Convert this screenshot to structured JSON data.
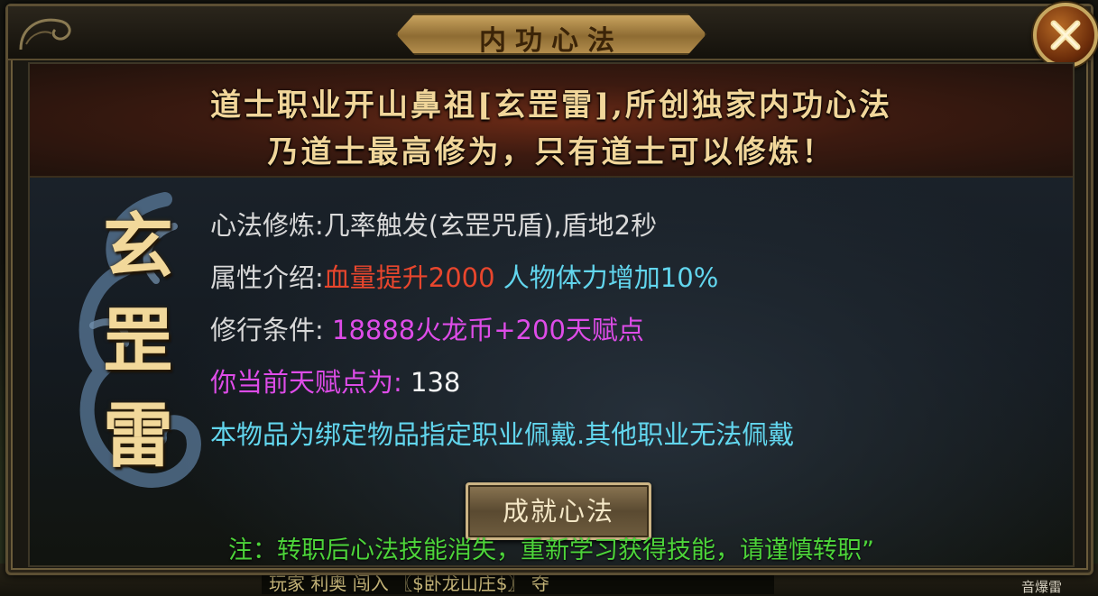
{
  "dialog": {
    "title": "内功心法",
    "close_icon": "close-x-icon",
    "banner": {
      "line1": "道士职业开山鼻祖[玄罡雷],所创独家内功心法",
      "line2": "乃道士最高修为，只有道士可以修炼！"
    },
    "emblem": {
      "chars": [
        "玄",
        "罡",
        "雷"
      ]
    },
    "info": {
      "cultivation_label": "心法修炼:",
      "cultivation_value": "几率触发(玄罡咒盾),盾地2秒",
      "attribute_label": "属性介绍:",
      "attribute_red": "血量提升2000",
      "attribute_cyan": " 人物体力增加10%",
      "requirement_label": "修行条件:",
      "requirement_value": " 18888火龙币+200天赋点",
      "talent_label": "你当前天赋点为:",
      "talent_value": " 138",
      "bind_note": "本物品为绑定物品指定职业佩戴.其他职业无法佩戴"
    },
    "action_button_label": "成就心法",
    "warning_note": "注：转职后心法技能消失，重新学习获得技能，请谨慎转职”"
  },
  "background_strip": {
    "text": "玩家   利奥   闯入   〖$卧龙山庄$〗   夺",
    "right_text": "音爆雷"
  },
  "colors": {
    "title_gold": "#f1d69a",
    "label_gray": "#d9d9d9",
    "highlight_red": "#e8462d",
    "highlight_cyan": "#62d6ee",
    "highlight_magenta": "#de4ce8",
    "note_green": "#4dd43a"
  }
}
